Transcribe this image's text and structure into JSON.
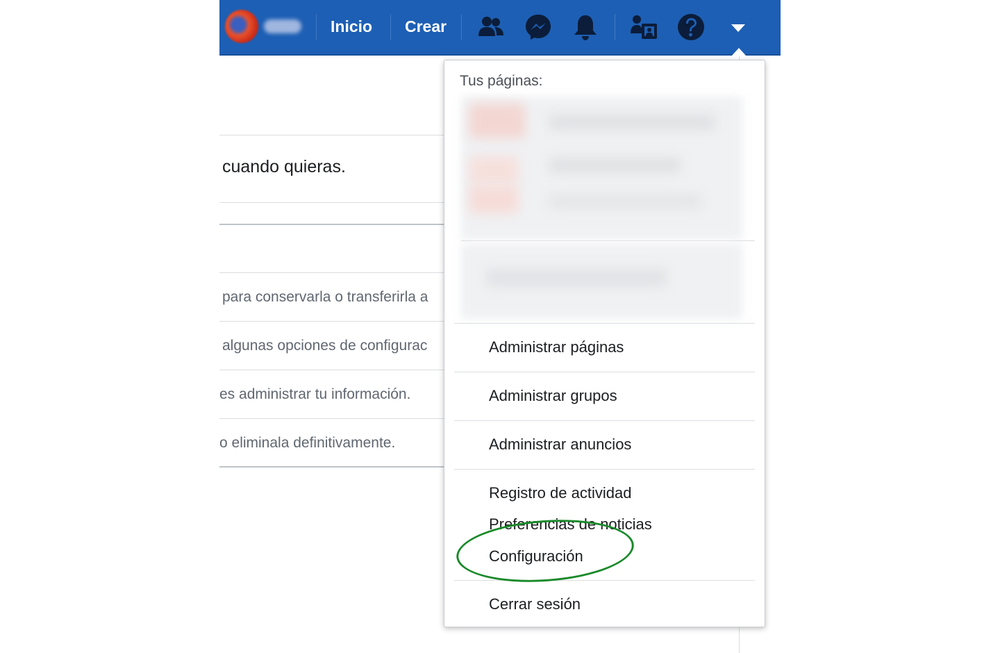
{
  "topbar": {
    "nav_home": "Inicio",
    "nav_create": "Crear",
    "icons": [
      "avatar",
      "friends-icon",
      "messenger-icon",
      "bell-icon",
      "quick-help-icon",
      "help-icon",
      "caret-down-icon"
    ],
    "bg_color": "#1d5fb4"
  },
  "background_page": {
    "main_text": "cuando quieras.",
    "rows": [
      "para conservarla o transferirla a",
      "algunas opciones de configurac",
      "es administrar tu información.",
      "o eliminala definitivamente."
    ]
  },
  "dropdown": {
    "header": "Tus páginas:",
    "items": {
      "manage_pages": "Administrar páginas",
      "manage_groups": "Administrar grupos",
      "manage_ads": "Administrar anuncios",
      "activity_log": "Registro de actividad",
      "news_prefs": "Preferencias de noticias",
      "settings": "Configuración",
      "logout": "Cerrar sesión"
    }
  },
  "annotation": {
    "ring_color": "#1a8a2a"
  }
}
